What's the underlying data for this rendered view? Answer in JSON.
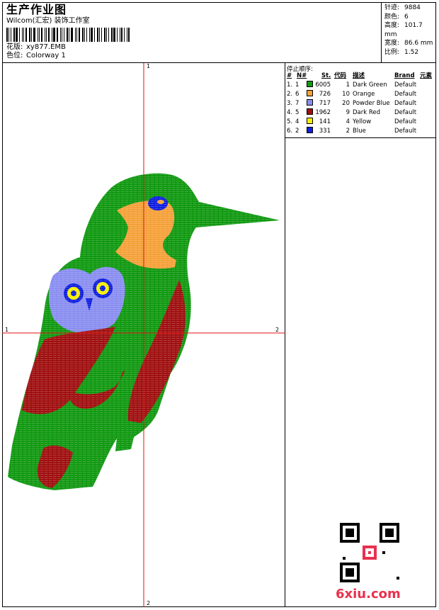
{
  "header": {
    "title": "生产作业图",
    "company": "Wilcom(汇宏) 装饰工作室",
    "design_label": "花版:",
    "design_value": "xy877.EMB",
    "colorway_label": "色位:",
    "colorway_value": "Colorway 1"
  },
  "stats": [
    {
      "label": "针迹:",
      "value": "9884"
    },
    {
      "label": "颜色:",
      "value": "6"
    },
    {
      "label": "高度:",
      "value": "101.7 mm"
    },
    {
      "label": "宽度:",
      "value": "86.6 mm"
    },
    {
      "label": "比例:",
      "value": "1.52"
    }
  ],
  "stop_table": {
    "caption": "停止顺序:",
    "headers": {
      "idx": "#",
      "n": "N#",
      "st": "St.",
      "code": "代码",
      "desc": "描述",
      "brand": "Brand",
      "elem": "元素"
    },
    "rows": [
      {
        "idx": "1.",
        "n": "1",
        "color": "#119911",
        "st": "6005",
        "code": "1",
        "desc": "Dark Green",
        "brand": "Default"
      },
      {
        "idx": "2.",
        "n": "6",
        "color": "#f5a13a",
        "st": "726",
        "code": "10",
        "desc": "Orange",
        "brand": "Default"
      },
      {
        "idx": "3.",
        "n": "7",
        "color": "#8a8ef0",
        "st": "717",
        "code": "20",
        "desc": "Powder Blue",
        "brand": "Default"
      },
      {
        "idx": "4.",
        "n": "5",
        "color": "#a01010",
        "st": "1962",
        "code": "9",
        "desc": "Dark Red",
        "brand": "Default"
      },
      {
        "idx": "5.",
        "n": "4",
        "color": "#f5f000",
        "st": "141",
        "code": "4",
        "desc": "Yellow",
        "brand": "Default"
      },
      {
        "idx": "6.",
        "n": "2",
        "color": "#1020e0",
        "st": "331",
        "code": "2",
        "desc": "Blue",
        "brand": "Default"
      }
    ]
  },
  "axes": {
    "top": "1",
    "bottom": "2",
    "left": "1",
    "right": "2",
    "color": "#e01010"
  },
  "watermark": {
    "site": "6xiu.com"
  },
  "colors": {
    "accent": "#e8314e"
  }
}
